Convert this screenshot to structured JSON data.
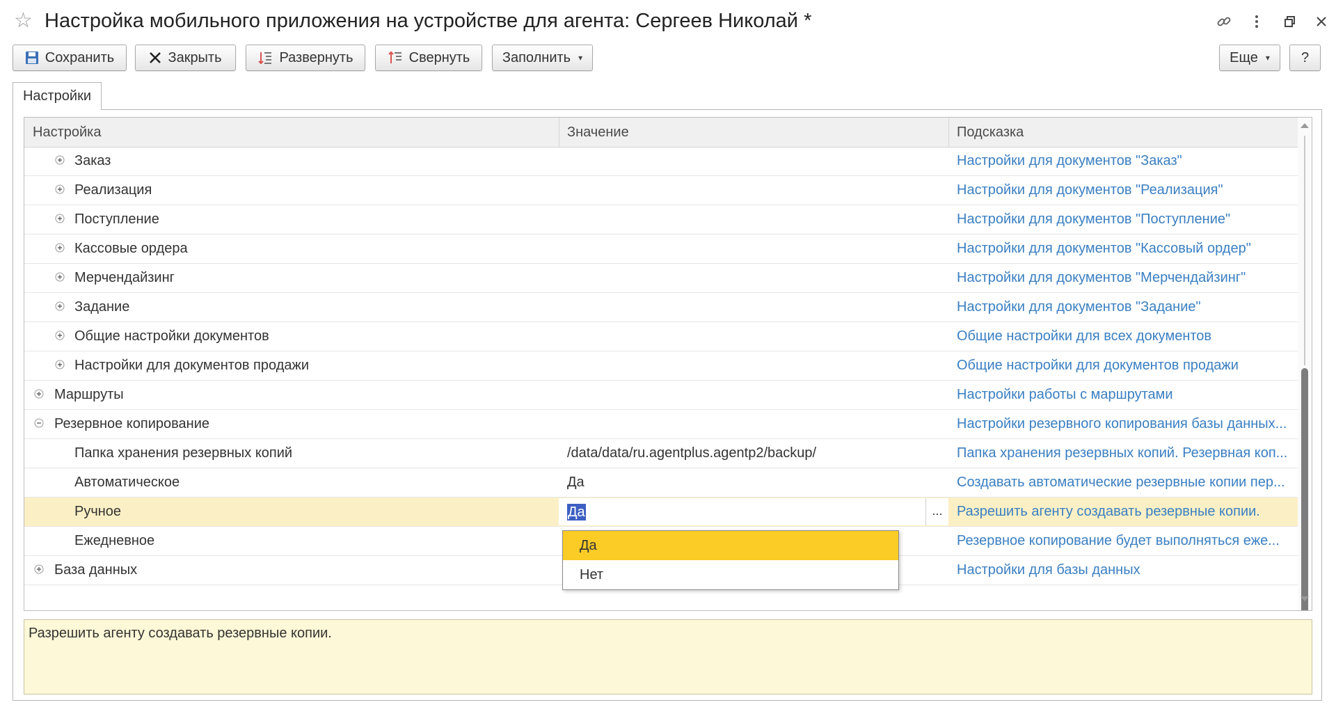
{
  "window": {
    "title": "Настройка мобильного приложения на устройстве для агента: Сергеев Николай *"
  },
  "toolbar": {
    "save_label": "Сохранить",
    "close_label": "Закрыть",
    "expand_label": "Развернуть",
    "collapse_label": "Свернуть",
    "fill_label": "Заполнить",
    "more_label": "Еще",
    "help_label": "?"
  },
  "tabs": [
    {
      "label": "Настройки"
    }
  ],
  "grid": {
    "columns": [
      "Настройка",
      "Значение",
      "Подсказка"
    ],
    "rows": [
      {
        "name": "Заказ",
        "value": "",
        "hint": "Настройки для документов \"Заказ\""
      },
      {
        "name": "Реализация",
        "value": "",
        "hint": "Настройки для документов \"Реализация\""
      },
      {
        "name": "Поступление",
        "value": "",
        "hint": "Настройки для документов \"Поступление\""
      },
      {
        "name": "Кассовые ордера",
        "value": "",
        "hint": "Настройки для документов \"Кассовый ордер\""
      },
      {
        "name": "Мерчендайзинг",
        "value": "",
        "hint": "Настройки для документов \"Мерчендайзинг\""
      },
      {
        "name": "Задание",
        "value": "",
        "hint": "Настройки для документов \"Задание\""
      },
      {
        "name": "Общие настройки документов",
        "value": "",
        "hint": "Общие настройки для всех документов"
      },
      {
        "name": "Настройки для документов продажи",
        "value": "",
        "hint": "Общие настройки для документов продажи"
      },
      {
        "name": "Маршруты",
        "value": "",
        "hint": "Настройки работы с маршрутами"
      },
      {
        "name": "Резервное копирование",
        "value": "",
        "hint": "Настройки резервного копирования базы данных..."
      },
      {
        "name": "Папка хранения резервных копий",
        "value": "/data/data/ru.agentplus.agentp2/backup/",
        "hint": "Папка хранения резервных копий. Резервная коп..."
      },
      {
        "name": "Автоматическое",
        "value": "Да",
        "hint": "Создавать автоматические резервные копии пер..."
      },
      {
        "name": "Ручное",
        "value": "Да",
        "hint": "Разрешить агенту создавать резервные копии."
      },
      {
        "name": "Ежедневное",
        "value": "",
        "hint": "Резервное копирование будет выполняться еже..."
      },
      {
        "name": "База данных",
        "value": "",
        "hint": "Настройки для базы данных"
      }
    ]
  },
  "editor": {
    "value": "Да",
    "dots": "...",
    "options": [
      "Да",
      "Нет"
    ],
    "selected_option": "Да"
  },
  "hint_panel": {
    "text": "Разрешить агенту создавать резервные копии."
  },
  "colors": {
    "accent_link": "#3a7fc2",
    "selected_row": "#fbf0c5",
    "dropdown_active": "#fbcb26",
    "hint_panel_bg": "#fdf8d7"
  }
}
